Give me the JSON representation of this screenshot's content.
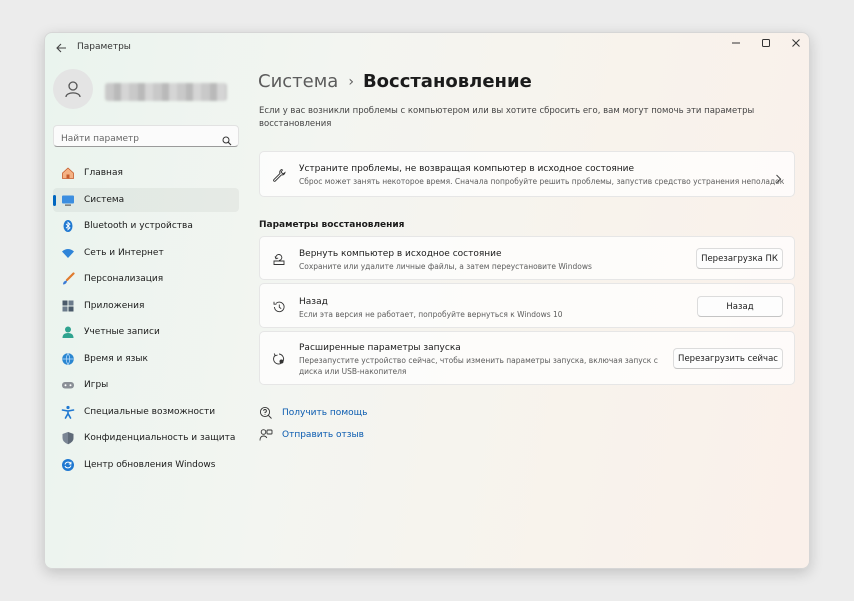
{
  "window": {
    "app_title": "Параметры"
  },
  "sidebar": {
    "search_placeholder": "Найти параметр",
    "items": [
      {
        "label": "Главная",
        "icon": "home-icon",
        "selected": false
      },
      {
        "label": "Система",
        "icon": "monitor-icon",
        "selected": true
      },
      {
        "label": "Bluetooth и устройства",
        "icon": "bluetooth-icon",
        "selected": false
      },
      {
        "label": "Сеть и Интернет",
        "icon": "wifi-icon",
        "selected": false
      },
      {
        "label": "Персонализация",
        "icon": "brush-icon",
        "selected": false
      },
      {
        "label": "Приложения",
        "icon": "apps-icon",
        "selected": false
      },
      {
        "label": "Учетные записи",
        "icon": "account-icon",
        "selected": false
      },
      {
        "label": "Время и язык",
        "icon": "globe-clock-icon",
        "selected": false
      },
      {
        "label": "Игры",
        "icon": "gamepad-icon",
        "selected": false
      },
      {
        "label": "Специальные возможности",
        "icon": "accessibility-icon",
        "selected": false
      },
      {
        "label": "Конфиденциальность и защита",
        "icon": "shield-icon",
        "selected": false
      },
      {
        "label": "Центр обновления Windows",
        "icon": "update-icon",
        "selected": false
      }
    ]
  },
  "main": {
    "breadcrumb": {
      "parent": "Система",
      "separator": "›",
      "current": "Восстановление"
    },
    "intro": "Если у вас возникли проблемы с компьютером или вы хотите сбросить его, вам могут помочь эти параметры восстановления",
    "troubleshoot_card": {
      "title": "Устраните проблемы, не возвращая компьютер в исходное состояние",
      "description": "Сброс может занять некоторое время. Сначала попробуйте решить проблемы, запустив средство устранения неполадок"
    },
    "section_title": "Параметры восстановления",
    "options": [
      {
        "title": "Вернуть компьютер в исходное состояние",
        "description": "Сохраните или удалите личные файлы, а затем переустановите Windows",
        "button": "Перезагрузка ПК"
      },
      {
        "title": "Назад",
        "description": "Если эта версия не работает, попробуйте вернуться к Windows 10",
        "button": "Назад"
      },
      {
        "title": "Расширенные параметры запуска",
        "description": "Перезапустите устройство сейчас, чтобы изменить параметры запуска, включая запуск с диска или USB-накопителя",
        "button": "Перезагрузить сейчас"
      }
    ],
    "links": [
      {
        "label": "Получить помощь",
        "icon": "help-icon"
      },
      {
        "label": "Отправить отзыв",
        "icon": "feedback-icon"
      }
    ]
  },
  "colors": {
    "accent": "#0067c0",
    "link": "#0a5bb0"
  }
}
